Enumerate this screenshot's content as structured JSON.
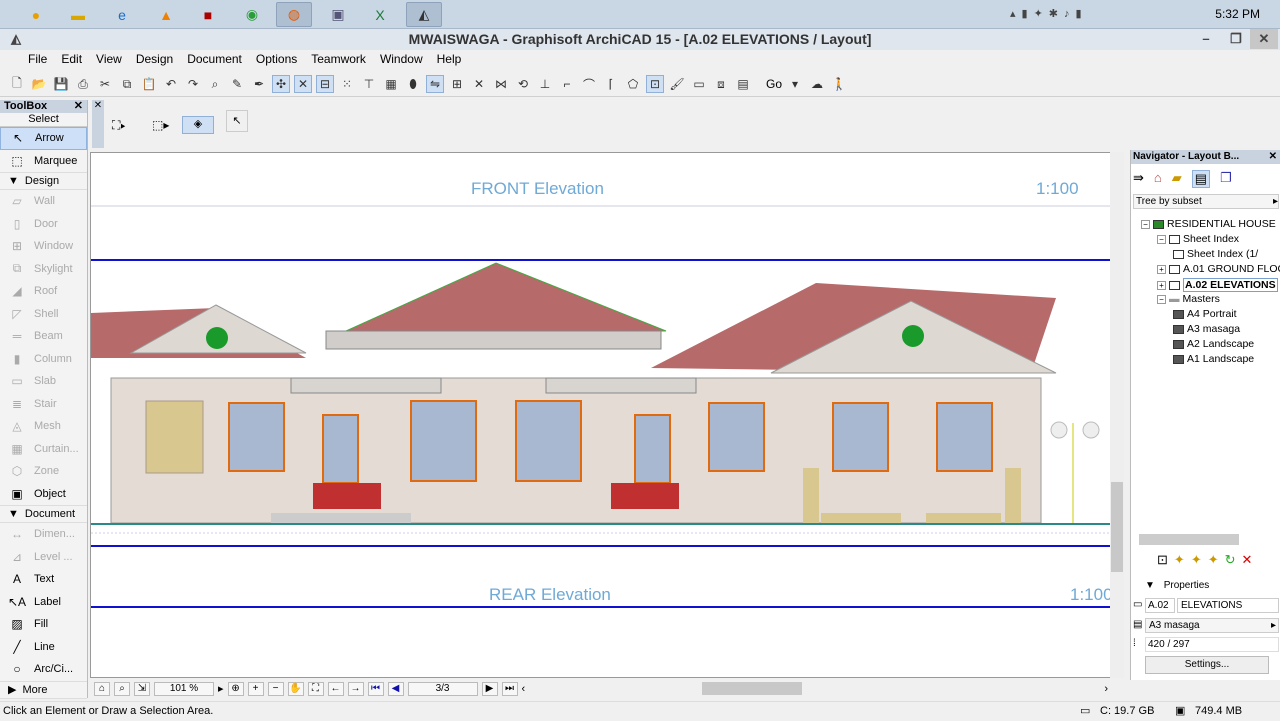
{
  "taskbar": {
    "clock": "5:32 PM",
    "apps": [
      "media-player",
      "file-explorer",
      "internet-explorer",
      "vlc",
      "photo-app",
      "chrome",
      "firefox",
      "remote-desktop",
      "excel",
      "archicad"
    ]
  },
  "window": {
    "title": "MWAISWAGA - Graphisoft ArchiCAD 15 - [A.02 ELEVATIONS / Layout]"
  },
  "menu": [
    "File",
    "Edit",
    "View",
    "Design",
    "Document",
    "Options",
    "Teamwork",
    "Window",
    "Help"
  ],
  "toolbar": {
    "go_label": "Go"
  },
  "toolbox": {
    "title": "ToolBox",
    "select_label": "Select",
    "select_tools": [
      {
        "label": "Arrow",
        "icon": "arrow-icon",
        "selected": true
      },
      {
        "label": "Marquee",
        "icon": "marquee-icon"
      }
    ],
    "design_label": "Design",
    "design_tools": [
      "Wall",
      "Door",
      "Window",
      "Skylight",
      "Roof",
      "Shell",
      "Beam",
      "Column",
      "Slab",
      "Stair",
      "Mesh",
      "Curtain...",
      "Zone",
      "Object"
    ],
    "document_label": "Document",
    "document_tools": [
      "Dimen...",
      "Level ...",
      "Text",
      "Label",
      "Fill",
      "Line",
      "Arc/Ci..."
    ],
    "more_label": "More"
  },
  "canvas": {
    "front_title": "FRONT  Elevation",
    "front_scale": "1:100",
    "rear_title": "REAR Elevation",
    "rear_scale": "1:100"
  },
  "navbar": {
    "zoom": "101 %",
    "page": "3/3"
  },
  "status": {
    "message": "Click an Element or Draw a Selection Area.",
    "disk": "C: 19.7 GB",
    "memory": "749.4 MB"
  },
  "navigator": {
    "title": "Navigator - Layout B...",
    "view_mode": "Tree by subset",
    "tree": [
      {
        "label": "RESIDENTIAL HOUSE",
        "level": 0
      },
      {
        "label": "Sheet Index",
        "level": 1
      },
      {
        "label": "Sheet Index (1/",
        "level": 2
      },
      {
        "label": "A.01 GROUND FLOC",
        "level": 1
      },
      {
        "label": "A.02 ELEVATIONS",
        "level": 1,
        "selected": true
      },
      {
        "label": "Masters",
        "level": 1
      },
      {
        "label": "A4 Portrait",
        "level": 2
      },
      {
        "label": "A3 masaga",
        "level": 2
      },
      {
        "label": "A2 Landscape",
        "level": 2
      },
      {
        "label": "A1 Landscape",
        "level": 2
      }
    ],
    "properties": {
      "label": "Properties",
      "id": "A.02",
      "name": "ELEVATIONS",
      "master": "A3 masaga",
      "size": "420 / 297",
      "settings_label": "Settings..."
    }
  }
}
